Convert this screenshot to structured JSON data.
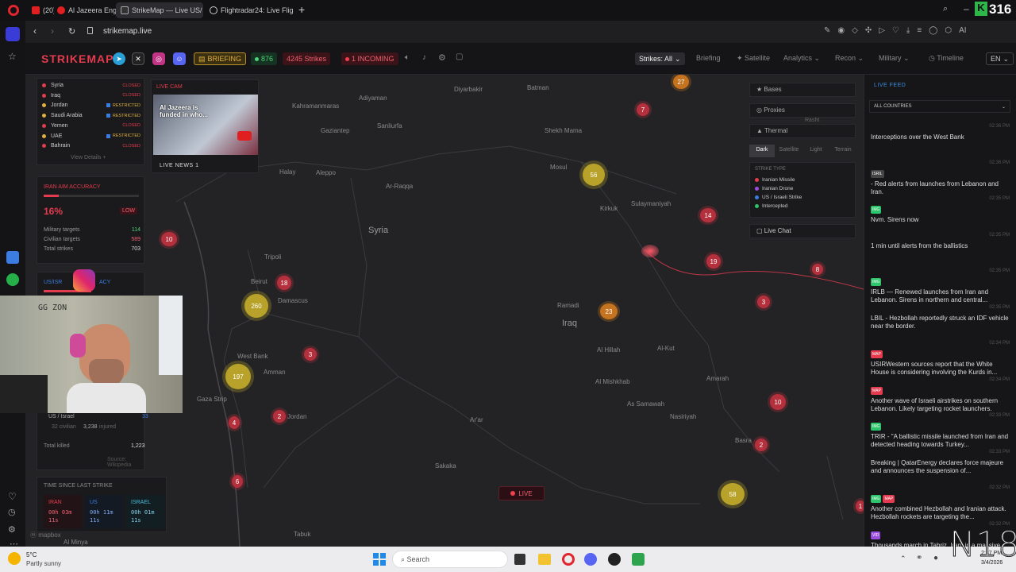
{
  "browser": {
    "tabs": [
      {
        "label": "(20)"
      },
      {
        "label": "Al Jazeera English"
      },
      {
        "label": "StrikeMap — Live US/"
      },
      {
        "label": "Flightradar24: Live Flight T"
      }
    ],
    "url": "strikemap.live",
    "corner_score": "316"
  },
  "header": {
    "logo_a": "STRIKE",
    "logo_b": "MAP",
    "briefing_badge": "BRIEFING",
    "online": "876",
    "strikes": "4245 Strikes",
    "incoming": "1 INCOMING",
    "nav": {
      "strikes_all": "Strikes: All",
      "briefing": "Briefing",
      "satellite": "Satellite",
      "analytics": "Analytics",
      "recon": "Recon",
      "military": "Military",
      "timeline": "Timeline",
      "lang": "EN"
    }
  },
  "airspace": [
    {
      "name": "Syria",
      "status": "CLOSED"
    },
    {
      "name": "Iraq",
      "status": "CLOSED"
    },
    {
      "name": "Jordan",
      "status": "RESTRICTED"
    },
    {
      "name": "Saudi Arabia",
      "status": "RESTRICTED"
    },
    {
      "name": "Yemen",
      "status": "CLOSED"
    },
    {
      "name": "UAE",
      "status": "RESTRICTED"
    },
    {
      "name": "Bahrain",
      "status": "CLOSED"
    }
  ],
  "view_details": "View Details +",
  "livecam": {
    "label": "LIVE CAM",
    "video_caption": "Al Jazeera is funded in who...",
    "channel": "LIVE NEWS 1"
  },
  "aim": {
    "title": "IRAN AIM ACCURACY",
    "value": "16%",
    "badge": "LOW",
    "rows": [
      {
        "k": "Military targets",
        "v": "114"
      },
      {
        "k": "Civilian targets",
        "v": "589"
      },
      {
        "k": "Total strikes",
        "v": "703"
      }
    ],
    "accuracy_fraction": 0.16
  },
  "usisr": {
    "title": "US/ISR",
    "title_rest": "ACY"
  },
  "casualties": {
    "label": "US / Israel",
    "num": "33",
    "civ": "32 civilian",
    "inj": "3,238",
    "inj_label": "injured",
    "total_label": "Total killed",
    "total": "1,223",
    "source": "Source: Wikipedia"
  },
  "since": {
    "title": "TIME SINCE LAST STRIKE",
    "items": [
      {
        "who": "IRAN",
        "t1": "00h 03m",
        "t2": "11s"
      },
      {
        "who": "US",
        "t1": "00h 11m",
        "t2": "11s"
      },
      {
        "who": "ISRAEL",
        "t1": "00h 01m",
        "t2": "11s"
      }
    ]
  },
  "map_places": [
    {
      "n": "Diyarbakir"
    },
    {
      "n": "Batman"
    },
    {
      "n": "Kahramanmaras"
    },
    {
      "n": "Adiyaman"
    },
    {
      "n": "Gaziantep"
    },
    {
      "n": "Sanliurfa"
    },
    {
      "n": "Halay"
    },
    {
      "n": "Aleppo"
    },
    {
      "n": "Ar-Raqqa"
    },
    {
      "n": "Mosul"
    },
    {
      "n": "Shekh Mama"
    },
    {
      "n": "Kirkuk"
    },
    {
      "n": "Sulaymaniyah"
    },
    {
      "n": "Tripoli"
    },
    {
      "n": "Beirut"
    },
    {
      "n": "Damascus"
    },
    {
      "n": "Ramadi"
    },
    {
      "n": "West Bank"
    },
    {
      "n": "Amman"
    },
    {
      "n": "Gaza Strip"
    },
    {
      "n": "Jordan"
    },
    {
      "n": "Al Hillah"
    },
    {
      "n": "Al-Kut"
    },
    {
      "n": "Al Mishkhab"
    },
    {
      "n": "Amarah"
    },
    {
      "n": "As Samawah"
    },
    {
      "n": "Nasiriyah"
    },
    {
      "n": "Basra"
    },
    {
      "n": "Ar'ar"
    },
    {
      "n": "Sakaka"
    },
    {
      "n": "Tabuk"
    },
    {
      "n": "Al Minya"
    }
  ],
  "countries": {
    "syria": "Syria",
    "iraq": "Iraq"
  },
  "clusters": [
    "27",
    "7",
    "56",
    "14",
    "19",
    "8",
    "3",
    "10",
    "18",
    "260",
    "197",
    "3",
    "23",
    "2",
    "4",
    "6",
    "10",
    "2",
    "58",
    "1",
    "8"
  ],
  "live_badge": "LIVE",
  "layers": {
    "bases": "Bases",
    "proxies": "Proxies",
    "thermal": "Thermal",
    "rash": "Rasht",
    "styles": [
      "Dark",
      "Satellite",
      "Light",
      "Terrain"
    ],
    "strike_type_title": "STRIKE TYPE",
    "types": [
      {
        "n": "Iranian Missile",
        "c": "#e43b4e"
      },
      {
        "n": "Iranian Drone",
        "c": "#9b4de0"
      },
      {
        "n": "US / Israeli Strike",
        "c": "#3a7de0"
      },
      {
        "n": "Intercepted",
        "c": "#2ec46b"
      }
    ],
    "live_chat": "Live Chat"
  },
  "feed": {
    "title": "LIVE FEED",
    "filter": "ALL COUNTRIES",
    "items": [
      {
        "t": "02:36 PM",
        "tag": "",
        "txt": "Interceptions over the West Bank"
      },
      {
        "t": "02:36 PM",
        "tag": "ISRIL",
        "txt": " - Red alerts from launches from Lebanon and Iran."
      },
      {
        "t": "02:35 PM",
        "tag": "IMG",
        "txt": "Nvm. Sirens now"
      },
      {
        "t": "02:35 PM",
        "tag": "",
        "txt": "1 min until alerts from the ballistics"
      },
      {
        "t": "02:35 PM",
        "tag": "IMG",
        "txt": "IRLB — Renewed launches from Iran and Lebanon. Sirens in northern and central..."
      },
      {
        "t": "02:35 PM",
        "tag": "",
        "txt": "LBIL - Hezbollah reportedly struck an IDF vehicle near the border."
      },
      {
        "t": "02:34 PM",
        "tag": "MAP",
        "txt": "USIRWestern sources report that the White House is considering involving the Kurds in..."
      },
      {
        "t": "02:34 PM",
        "tag": "MAP",
        "txt": "Another wave of Israeli airstrikes on southern Lebanon. Likely targeting rocket launchers."
      },
      {
        "t": "02:33 PM",
        "tag": "IMG",
        "txt": "TRIR - \"A ballistic missile launched from Iran and detected heading towards Turkey..."
      },
      {
        "t": "02:33 PM",
        "tag": "",
        "txt": "Breaking | QatarEnergy declares force majeure and announces the suspension of..."
      },
      {
        "t": "02:32 PM",
        "tag": "IMG MAP",
        "txt": "Another combined Hezbollah and Iranian attack. Hezbollah rockets are targeting the..."
      },
      {
        "t": "02:32 PM",
        "tag": "VID",
        "txt": "Thousands march in Tabriz, Iran, in a massive protest expressing anger over the..."
      }
    ]
  },
  "taskbar": {
    "temp": "5°C",
    "weather": "Partly sunny",
    "search": "Search",
    "time": "2:37 PM",
    "date": "3/4/2026"
  },
  "watermark": "N18",
  "webcam_text": "GG ZON"
}
